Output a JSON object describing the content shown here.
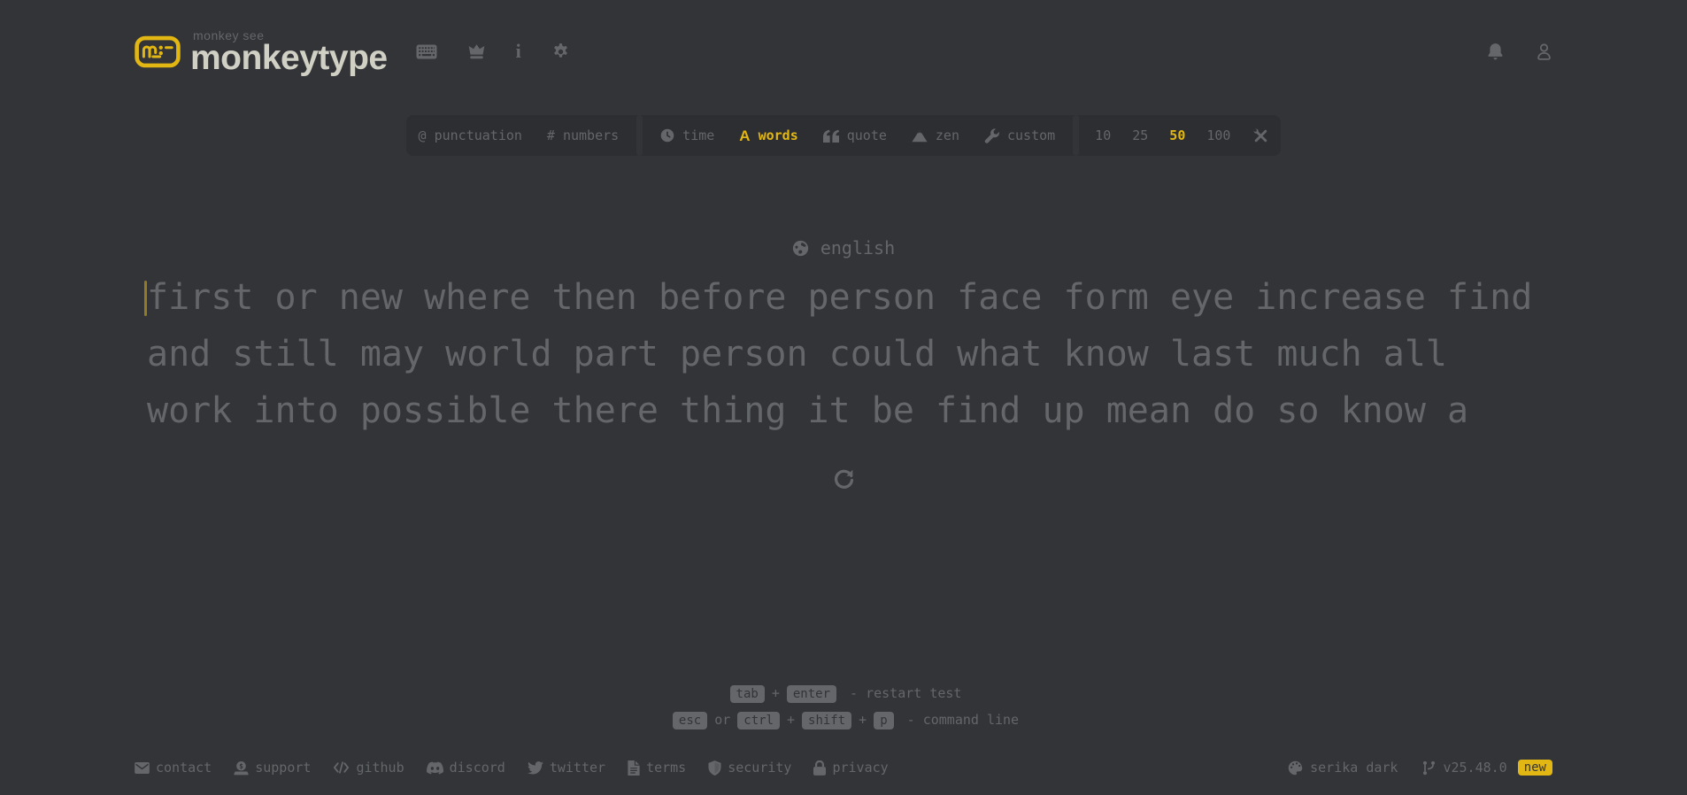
{
  "header": {
    "tagline": "monkey see",
    "title": "monkeytype"
  },
  "config": {
    "punctuation": "punctuation",
    "numbers": "numbers",
    "time": "time",
    "words": "words",
    "quote": "quote",
    "zen": "zen",
    "custom": "custom",
    "counts": [
      "10",
      "25",
      "50",
      "100"
    ],
    "active_mode": "words",
    "active_count": "50"
  },
  "test": {
    "language": "english",
    "lines": [
      "first or new where then before person face form eye increase find",
      "and still may world part person could what know last much all",
      "work into possible there thing it be find up mean do so know a"
    ]
  },
  "shortcuts": {
    "tab": "tab",
    "plus1": "+",
    "enter": "enter",
    "restart_desc": "- restart test",
    "esc": "esc",
    "or": "or",
    "ctrl": "ctrl",
    "plus2": "+",
    "shift": "shift",
    "plus3": "+",
    "p": "p",
    "command_desc": "- command line"
  },
  "footer": {
    "links": [
      {
        "label": "contact"
      },
      {
        "label": "support"
      },
      {
        "label": "github"
      },
      {
        "label": "discord"
      },
      {
        "label": "twitter"
      },
      {
        "label": "terms"
      },
      {
        "label": "security"
      },
      {
        "label": "privacy"
      }
    ],
    "theme": "serika dark",
    "version": "v25.48.0",
    "badge": "new"
  },
  "colors": {
    "background": "#323437",
    "surface": "#2c2e31",
    "sub": "#646669",
    "text": "#d1d0c5",
    "accent": "#e2b714"
  }
}
